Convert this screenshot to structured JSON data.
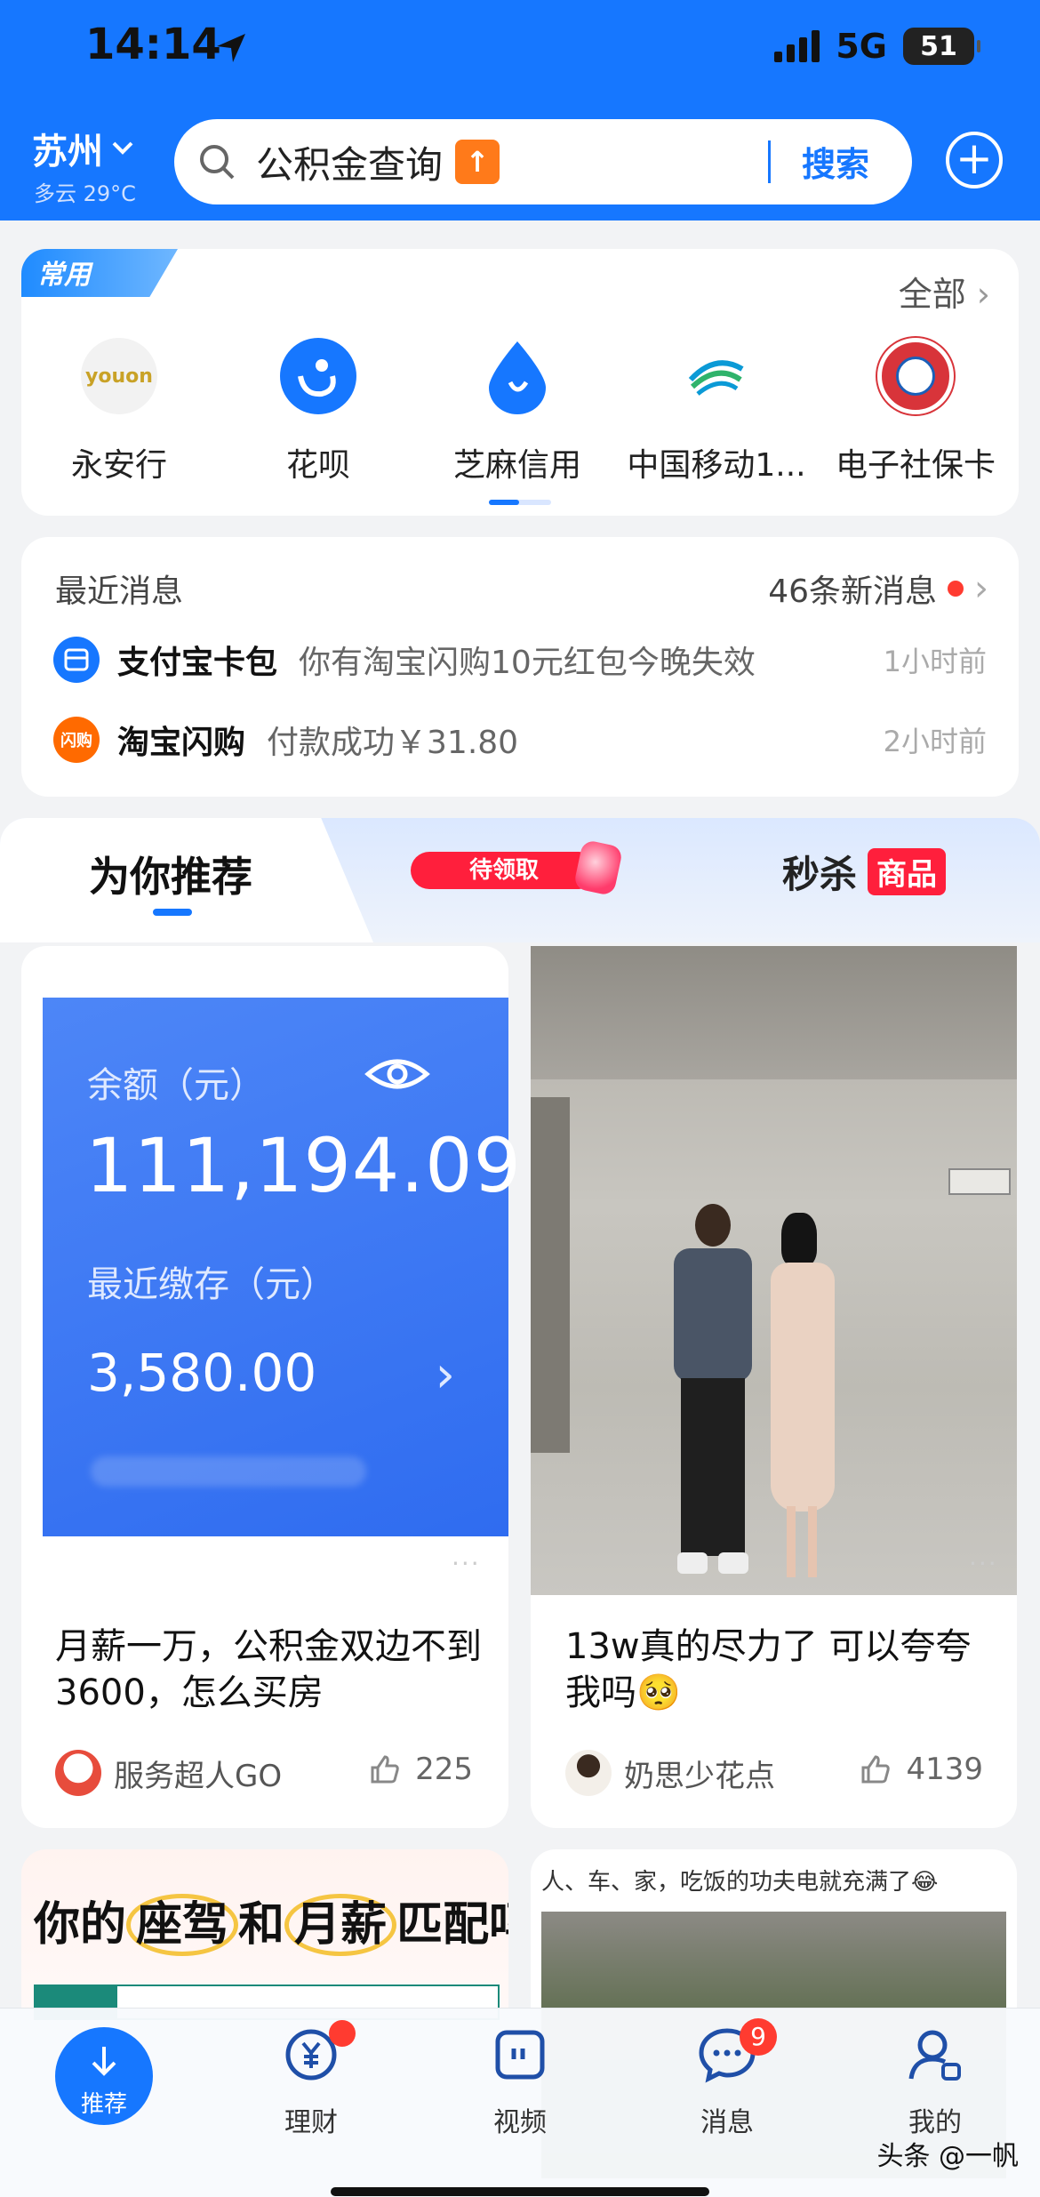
{
  "status": {
    "time": "14:14",
    "network": "5G",
    "battery": "51"
  },
  "header": {
    "city": "苏州",
    "weather": "多云 29°C",
    "search_query": "公积金查询",
    "hot_icon": "↑",
    "search_button": "搜索"
  },
  "apps": {
    "tag": "常用",
    "all_label": "全部",
    "items": [
      {
        "label": "永安行",
        "icon": "youon-icon",
        "text": "youon"
      },
      {
        "label": "花呗",
        "icon": "huabei-icon"
      },
      {
        "label": "芝麻信用",
        "icon": "sesame-credit-icon"
      },
      {
        "label": "中国移动1...",
        "icon": "china-mobile-icon"
      },
      {
        "label": "电子社保卡",
        "icon": "social-security-icon"
      }
    ]
  },
  "messages": {
    "title": "最近消息",
    "count_label": "46条新消息",
    "items": [
      {
        "source": "支付宝卡包",
        "text": "你有淘宝闪购10元红包今晚失效",
        "time": "1小时前",
        "icon": "card-wallet-icon"
      },
      {
        "source": "淘宝闪购",
        "text": "付款成功￥31.80",
        "time": "2小时前",
        "icon": "taobao-flash-icon",
        "icon_text": "闪购"
      }
    ]
  },
  "feed_tabs": {
    "active": "为你推荐",
    "promo": "待领取",
    "deals": "秒杀",
    "deals_badge": "商品"
  },
  "feed": [
    {
      "panel": {
        "balance_label": "余额（元）",
        "balance": "111,194.09",
        "recent_label": "最近缴存（元）",
        "recent_amount": "3,580.00"
      },
      "title": "月薪一万，公积金双边不到3600，怎么买房",
      "author": "服务超人GO",
      "likes": "225"
    },
    {
      "title": "13w真的尽力了 可以夸夸我吗🥺",
      "author": "奶思少花点",
      "likes": "4139"
    }
  ],
  "more": {
    "promo_title_a": "你的",
    "promo_title_b": "座驾",
    "promo_title_c": "和",
    "promo_title_d": "月薪",
    "promo_title_e": "匹配吗?",
    "card2_text": "人、车、家，吃饭的功夫电就充满了😂"
  },
  "tabbar": {
    "home": "推荐",
    "items": [
      "理财",
      "视频",
      "消息",
      "我的"
    ],
    "msg_badge": "9"
  },
  "watermark": "头条 @一帆"
}
